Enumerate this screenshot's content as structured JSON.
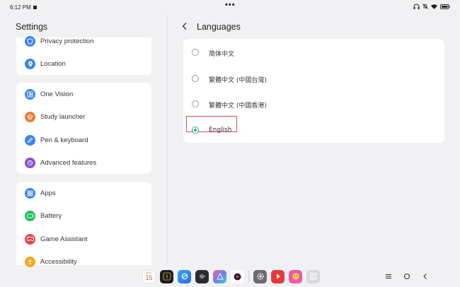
{
  "status": {
    "time": "6:12 PM",
    "dots": "•••"
  },
  "left": {
    "title": "Settings",
    "groups": [
      [
        {
          "label": "Privacy protection",
          "icon": "shield-icon",
          "color": "#3a82f0"
        },
        {
          "label": "Location",
          "icon": "location-pin-icon",
          "color": "#3a82f0"
        }
      ],
      [
        {
          "label": "One Vision",
          "icon": "one-vision-icon",
          "color": "#3a82f0"
        },
        {
          "label": "Study launcher",
          "icon": "study-launcher-icon",
          "color": "#f07a30"
        },
        {
          "label": "Pen & keyboard",
          "icon": "pen-icon",
          "color": "#3a82f0"
        },
        {
          "label": "Advanced features",
          "icon": "advanced-features-icon",
          "color": "#8a4fd6"
        }
      ],
      [
        {
          "label": "Apps",
          "icon": "apps-icon",
          "color": "#3a82f0"
        },
        {
          "label": "Battery",
          "icon": "battery-icon",
          "color": "#1fbf5a"
        },
        {
          "label": "Game Assistant",
          "icon": "game-assistant-icon",
          "color": "#e8434b"
        },
        {
          "label": "Accessibility",
          "icon": "accessibility-icon",
          "color": "#f2a51e"
        }
      ]
    ]
  },
  "right": {
    "title": "Languages",
    "options": [
      {
        "label": "简体中文",
        "selected": false
      },
      {
        "label": "繁體中文 (中國台灣)",
        "selected": false
      },
      {
        "label": "繁體中文 (中國香港)",
        "selected": false
      },
      {
        "label": "English",
        "selected": true
      }
    ],
    "accent_color": "#25b07a"
  },
  "dock": {
    "calendar_weekday": "WED",
    "calendar_day": "15",
    "apps": [
      "calendar-app",
      "camera-app",
      "browser-app",
      "voice-app",
      "gallery-app",
      "music-app",
      "settings-app",
      "video-app",
      "assistant-app",
      "app-grid"
    ]
  }
}
